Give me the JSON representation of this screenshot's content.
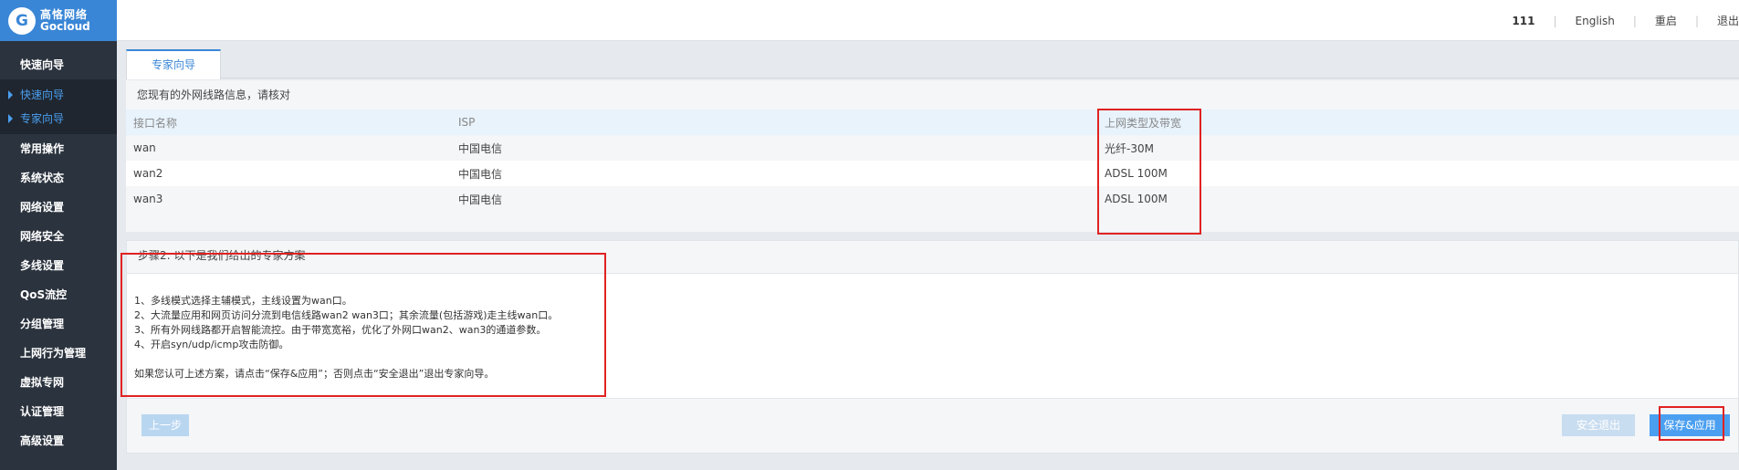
{
  "brand": {
    "name_cn": "高恪网络",
    "name_en": "Gocloud",
    "logo_icon": "gocloud-logo-icon"
  },
  "header": {
    "user": "111",
    "language": "English",
    "restart": "重启",
    "logout": "退出"
  },
  "sidebar": {
    "items": [
      {
        "label": "快速向导"
      },
      {
        "label": "常用操作"
      },
      {
        "label": "系统状态"
      },
      {
        "label": "网络设置"
      },
      {
        "label": "网络安全"
      },
      {
        "label": "多线设置"
      },
      {
        "label": "QoS流控"
      },
      {
        "label": "分组管理"
      },
      {
        "label": "上网行为管理"
      },
      {
        "label": "虚拟专网"
      },
      {
        "label": "认证管理"
      },
      {
        "label": "高级设置"
      }
    ],
    "subitems": [
      {
        "label": "快速向导"
      },
      {
        "label": "专家向导"
      }
    ]
  },
  "tabs": [
    {
      "label": "专家向导"
    }
  ],
  "wan_info": {
    "title": "您现有的外网线路信息，请核对",
    "columns": [
      "接口名称",
      "ISP",
      "上网类型及带宽"
    ],
    "rows": [
      [
        "wan",
        "中国电信",
        "光纤-30M"
      ],
      [
        "wan2",
        "中国电信",
        "ADSL 100M"
      ],
      [
        "wan3",
        "中国电信",
        "ADSL 100M"
      ]
    ]
  },
  "plan": {
    "title": "步骤2: 以下是我们给出的专家方案",
    "lines": [
      "1、多线模式选择主辅模式，主线设置为wan口。",
      "2、大流量应用和网页访问分流到电信线路wan2 wan3口；其余流量(包括游戏)走主线wan口。",
      "3、所有外网线路都开启智能流控。由于带宽宽裕，优化了外网口wan2、wan3的通道参数。",
      "4、开启syn/udp/icmp攻击防御。"
    ],
    "note": "如果您认可上述方案，请点击“保存&应用”；否则点击“安全退出”退出专家向导。"
  },
  "buttons": {
    "prev": "上一步",
    "exit": "安全退出",
    "save": "保存&应用"
  },
  "colors": {
    "accent": "#3a86d6",
    "sidebar_bg": "#2b333e",
    "highlight": "#e02222"
  }
}
